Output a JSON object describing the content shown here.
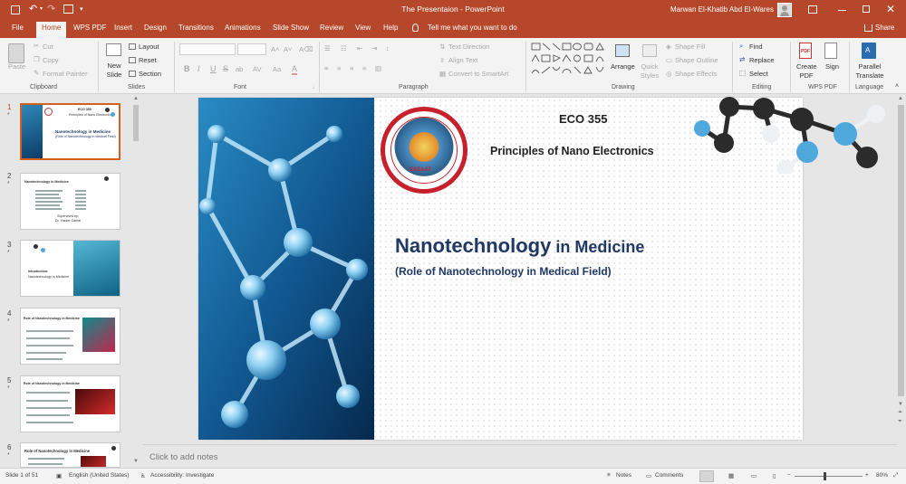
{
  "titlebar": {
    "document_title": "The Presentaion  -  PowerPoint",
    "user_name": "Marwan El-Khatib Abd El-Wares",
    "share_label": "Share"
  },
  "tabs": [
    "File",
    "Home",
    "WPS PDF",
    "Insert",
    "Design",
    "Transitions",
    "Animations",
    "Slide Show",
    "Review",
    "View",
    "Help"
  ],
  "tell_me": "Tell me what you want to do",
  "ribbon": {
    "clipboard": {
      "paste": "Paste",
      "cut": "Cut",
      "copy": "Copy",
      "format_painter": "Format Painter",
      "label": "Clipboard"
    },
    "slides": {
      "new_slide": "New Slide",
      "layout": "Layout",
      "reset": "Reset",
      "section": "Section",
      "label": "Slides"
    },
    "font": {
      "label": "Font",
      "bold": "B",
      "italic": "I",
      "underline": "U",
      "strike": "S",
      "shadow": "ab",
      "spacing": "AV",
      "case": "Aa",
      "font_color": "A"
    },
    "paragraph": {
      "text_direction": "Text Direction",
      "align_text": "Align Text",
      "smartart": "Convert to SmartArt",
      "label": "Paragraph"
    },
    "drawing": {
      "arrange": "Arrange",
      "quick_styles": "Quick Styles",
      "shape_fill": "Shape Fill",
      "shape_outline": "Shape Outline",
      "shape_effects": "Shape Effects",
      "label": "Drawing"
    },
    "editing": {
      "find": "Find",
      "replace": "Replace",
      "select": "Select",
      "label": "Editing"
    },
    "wps": {
      "create_pdf": "Create PDF",
      "sign": "Sign",
      "label": "WPS PDF"
    },
    "language": {
      "translate": "Parallel Translate",
      "label": "Language"
    }
  },
  "thumbnails": [
    {
      "number": "1",
      "mark": "*",
      "title": "Nanotechnology in Medicine",
      "subtitle": "(Role of Nanotechnology in Medical Field)",
      "course": "ECO 355",
      "course_title": "Principles of Nano Electronics"
    },
    {
      "number": "2",
      "mark": "*",
      "title": "Nanotechnology in Medicine",
      "supervised": "Supervised by:",
      "supervisor": "Dr. Yasser Gamal"
    },
    {
      "number": "3",
      "mark": "*",
      "title": "Introduction:",
      "subtitle": "Nanotechnology in Medicine"
    },
    {
      "number": "4",
      "mark": "*",
      "title": "Role of Nanotechnology in Medicine"
    },
    {
      "number": "5",
      "mark": "*",
      "title": "Role of Nanotechnology in Medicine"
    },
    {
      "number": "6",
      "mark": "*",
      "title": "Role of Nanotechnology in Medicine"
    }
  ],
  "slide": {
    "course_code": "ECO 355",
    "course_title": "Principles of Nano Electronics",
    "title_part1": "Nanotechnology",
    "title_part2": " in Medicine",
    "subtitle": "(Role of Nanotechnology in Medical Field)",
    "logo_text": "EAE&AT"
  },
  "notes_placeholder": "Click to add notes",
  "status": {
    "slide_of": "Slide 1 of 51",
    "language": "English (United States)",
    "accessibility": "Accessibility: Investigate",
    "notes": "Notes",
    "comments": "Comments",
    "zoom": "80%"
  },
  "colors": {
    "accent": "#b7472a",
    "title_blue": "#1f3864",
    "atom_dark": "#2b2b2b",
    "atom_blue": "#4fa8dc"
  }
}
